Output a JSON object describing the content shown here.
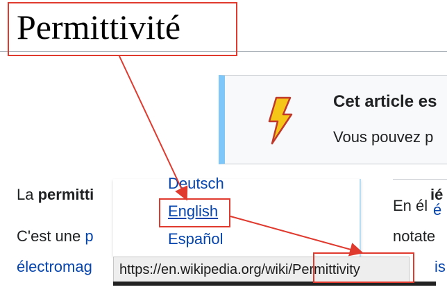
{
  "page": {
    "title": "Permittivité"
  },
  "notice": {
    "title": "Cet article es",
    "text": "Vous pouvez p",
    "icon": "lightning-bolt-icon"
  },
  "body": {
    "line1_prefix": "La ",
    "line1_bold": "permitti",
    "line2_prefix": "C'est une ",
    "line2_link": "p",
    "line3_link": "électromag",
    "right_bold": "ié",
    "right_line1": "En él",
    "right_line1_link": "é",
    "right_line2": "notate",
    "right_line3_link": "is"
  },
  "language_menu": {
    "items": [
      "Deutsch",
      "English",
      "Español"
    ],
    "hovered": "English"
  },
  "status_bar": {
    "url_prefix": "https://en.wikipedia.org/wiki/",
    "url_page": "Permittivity"
  },
  "colors": {
    "link": "#0645ad",
    "annotation": "#e03a2f",
    "notice_border": "#7fc7f8"
  }
}
